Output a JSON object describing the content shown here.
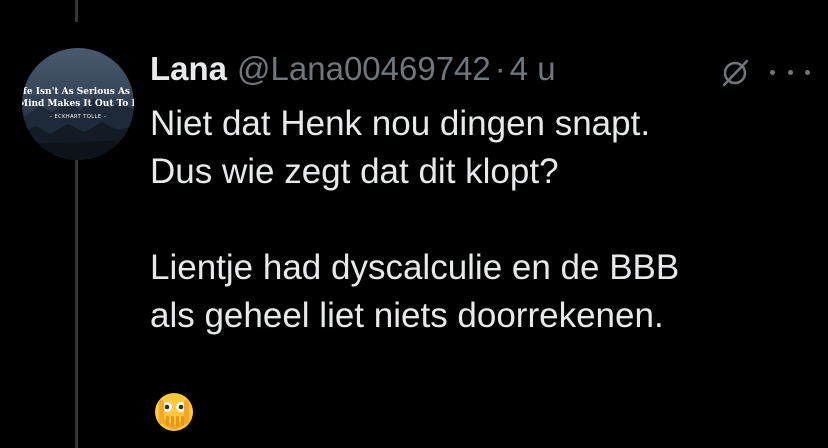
{
  "post": {
    "author_name": "Lana",
    "handle": "@Lana00469742",
    "separator": "·",
    "time": "4 u",
    "avatar": {
      "quote_line_1": "ife Isn't As Serious As Th",
      "quote_line_2": "Mind Makes It Out To Be.",
      "quote_author": "– ECKHART TOLLE –"
    },
    "text_lines": [
      "Niet dat Henk nou dingen snapt.",
      "Dus wie zegt dat dit klopt?",
      "",
      "Lientje had dyscalculie en de BBB",
      "als geheel liet niets doorrekenen."
    ],
    "emoji": "face-with-open-eyes-and-hand-over-mouth"
  },
  "icons": {
    "grok": "grok-icon",
    "more": "more-options-icon"
  },
  "colors": {
    "background": "#000000",
    "text": "#e7e9ea",
    "secondary": "#71767b",
    "thread_line": "#333639"
  }
}
